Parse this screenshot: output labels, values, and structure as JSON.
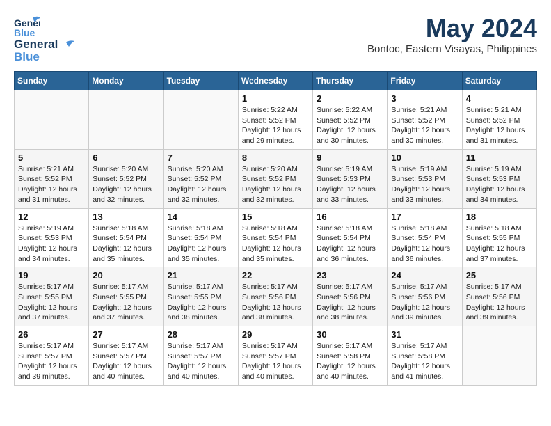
{
  "header": {
    "logo_line1": "General",
    "logo_line2": "Blue",
    "month_year": "May 2024",
    "location": "Bontoc, Eastern Visayas, Philippines"
  },
  "weekdays": [
    "Sunday",
    "Monday",
    "Tuesday",
    "Wednesday",
    "Thursday",
    "Friday",
    "Saturday"
  ],
  "weeks": [
    [
      {
        "day": "",
        "info": ""
      },
      {
        "day": "",
        "info": ""
      },
      {
        "day": "",
        "info": ""
      },
      {
        "day": "1",
        "info": "Sunrise: 5:22 AM\nSunset: 5:52 PM\nDaylight: 12 hours\nand 29 minutes."
      },
      {
        "day": "2",
        "info": "Sunrise: 5:22 AM\nSunset: 5:52 PM\nDaylight: 12 hours\nand 30 minutes."
      },
      {
        "day": "3",
        "info": "Sunrise: 5:21 AM\nSunset: 5:52 PM\nDaylight: 12 hours\nand 30 minutes."
      },
      {
        "day": "4",
        "info": "Sunrise: 5:21 AM\nSunset: 5:52 PM\nDaylight: 12 hours\nand 31 minutes."
      }
    ],
    [
      {
        "day": "5",
        "info": "Sunrise: 5:21 AM\nSunset: 5:52 PM\nDaylight: 12 hours\nand 31 minutes."
      },
      {
        "day": "6",
        "info": "Sunrise: 5:20 AM\nSunset: 5:52 PM\nDaylight: 12 hours\nand 32 minutes."
      },
      {
        "day": "7",
        "info": "Sunrise: 5:20 AM\nSunset: 5:52 PM\nDaylight: 12 hours\nand 32 minutes."
      },
      {
        "day": "8",
        "info": "Sunrise: 5:20 AM\nSunset: 5:52 PM\nDaylight: 12 hours\nand 32 minutes."
      },
      {
        "day": "9",
        "info": "Sunrise: 5:19 AM\nSunset: 5:53 PM\nDaylight: 12 hours\nand 33 minutes."
      },
      {
        "day": "10",
        "info": "Sunrise: 5:19 AM\nSunset: 5:53 PM\nDaylight: 12 hours\nand 33 minutes."
      },
      {
        "day": "11",
        "info": "Sunrise: 5:19 AM\nSunset: 5:53 PM\nDaylight: 12 hours\nand 34 minutes."
      }
    ],
    [
      {
        "day": "12",
        "info": "Sunrise: 5:19 AM\nSunset: 5:53 PM\nDaylight: 12 hours\nand 34 minutes."
      },
      {
        "day": "13",
        "info": "Sunrise: 5:18 AM\nSunset: 5:54 PM\nDaylight: 12 hours\nand 35 minutes."
      },
      {
        "day": "14",
        "info": "Sunrise: 5:18 AM\nSunset: 5:54 PM\nDaylight: 12 hours\nand 35 minutes."
      },
      {
        "day": "15",
        "info": "Sunrise: 5:18 AM\nSunset: 5:54 PM\nDaylight: 12 hours\nand 35 minutes."
      },
      {
        "day": "16",
        "info": "Sunrise: 5:18 AM\nSunset: 5:54 PM\nDaylight: 12 hours\nand 36 minutes."
      },
      {
        "day": "17",
        "info": "Sunrise: 5:18 AM\nSunset: 5:54 PM\nDaylight: 12 hours\nand 36 minutes."
      },
      {
        "day": "18",
        "info": "Sunrise: 5:18 AM\nSunset: 5:55 PM\nDaylight: 12 hours\nand 37 minutes."
      }
    ],
    [
      {
        "day": "19",
        "info": "Sunrise: 5:17 AM\nSunset: 5:55 PM\nDaylight: 12 hours\nand 37 minutes."
      },
      {
        "day": "20",
        "info": "Sunrise: 5:17 AM\nSunset: 5:55 PM\nDaylight: 12 hours\nand 37 minutes."
      },
      {
        "day": "21",
        "info": "Sunrise: 5:17 AM\nSunset: 5:55 PM\nDaylight: 12 hours\nand 38 minutes."
      },
      {
        "day": "22",
        "info": "Sunrise: 5:17 AM\nSunset: 5:56 PM\nDaylight: 12 hours\nand 38 minutes."
      },
      {
        "day": "23",
        "info": "Sunrise: 5:17 AM\nSunset: 5:56 PM\nDaylight: 12 hours\nand 38 minutes."
      },
      {
        "day": "24",
        "info": "Sunrise: 5:17 AM\nSunset: 5:56 PM\nDaylight: 12 hours\nand 39 minutes."
      },
      {
        "day": "25",
        "info": "Sunrise: 5:17 AM\nSunset: 5:56 PM\nDaylight: 12 hours\nand 39 minutes."
      }
    ],
    [
      {
        "day": "26",
        "info": "Sunrise: 5:17 AM\nSunset: 5:57 PM\nDaylight: 12 hours\nand 39 minutes."
      },
      {
        "day": "27",
        "info": "Sunrise: 5:17 AM\nSunset: 5:57 PM\nDaylight: 12 hours\nand 40 minutes."
      },
      {
        "day": "28",
        "info": "Sunrise: 5:17 AM\nSunset: 5:57 PM\nDaylight: 12 hours\nand 40 minutes."
      },
      {
        "day": "29",
        "info": "Sunrise: 5:17 AM\nSunset: 5:57 PM\nDaylight: 12 hours\nand 40 minutes."
      },
      {
        "day": "30",
        "info": "Sunrise: 5:17 AM\nSunset: 5:58 PM\nDaylight: 12 hours\nand 40 minutes."
      },
      {
        "day": "31",
        "info": "Sunrise: 5:17 AM\nSunset: 5:58 PM\nDaylight: 12 hours\nand 41 minutes."
      },
      {
        "day": "",
        "info": ""
      }
    ]
  ]
}
